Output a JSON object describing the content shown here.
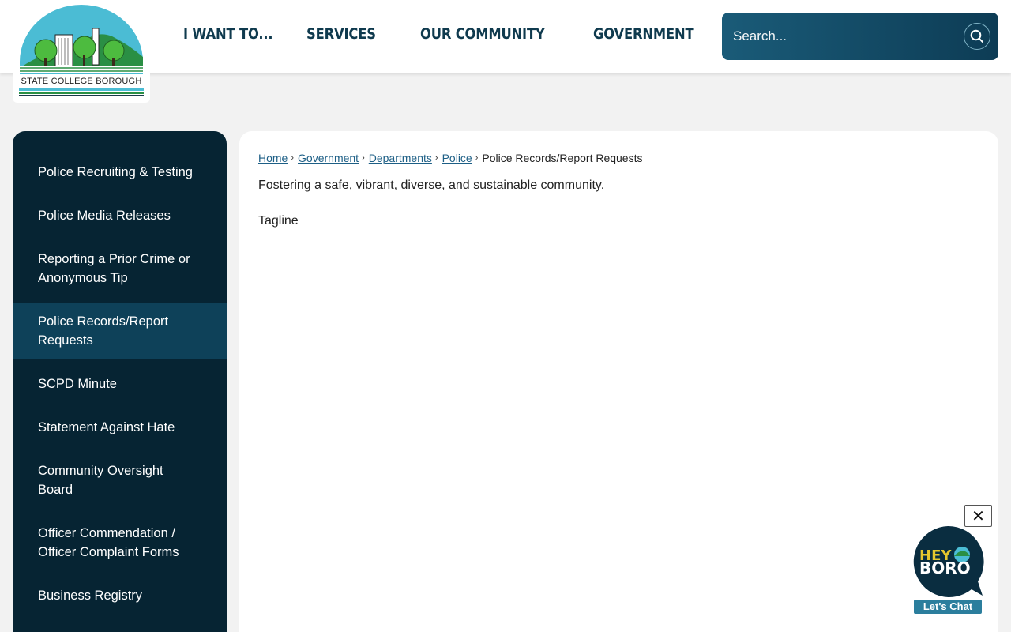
{
  "logo": {
    "text": "STATE COLLEGE BOROUGH"
  },
  "nav": {
    "items": [
      {
        "label": "I WANT TO..."
      },
      {
        "label": "SERVICES"
      },
      {
        "label": "OUR COMMUNITY"
      },
      {
        "label": "GOVERNMENT"
      }
    ]
  },
  "search": {
    "placeholder": "Search..."
  },
  "sidebar": {
    "items": [
      {
        "label": "Police Recruiting & Testing"
      },
      {
        "label": "Police Media Releases"
      },
      {
        "label": "Reporting a Prior Crime or Anonymous Tip"
      },
      {
        "label": "Police Records/Report Requests"
      },
      {
        "label": "SCPD Minute"
      },
      {
        "label": "Statement Against Hate"
      },
      {
        "label": "Community Oversight Board"
      },
      {
        "label": "Officer Commendation / Officer Complaint Forms"
      },
      {
        "label": "Business Registry"
      }
    ],
    "active_index": 3
  },
  "breadcrumb": {
    "items": [
      {
        "label": "Home"
      },
      {
        "label": "Government"
      },
      {
        "label": "Departments"
      },
      {
        "label": "Police"
      }
    ],
    "current": "Police Records/Report Requests",
    "separator": "›"
  },
  "content": {
    "tagline_text": "Fostering a safe, vibrant, diverse, and sustainable community.",
    "tagline_label": "Tagline"
  },
  "chat": {
    "close_icon": "✕",
    "hey": "HEY",
    "boro": "BORO",
    "cta": "Let's Chat"
  },
  "colors": {
    "dark_navy": "#062433",
    "active_item": "#0e4159",
    "nav_text": "#0f3a4e",
    "link": "#1d5f86",
    "chat_teal": "#2b7e9d"
  }
}
